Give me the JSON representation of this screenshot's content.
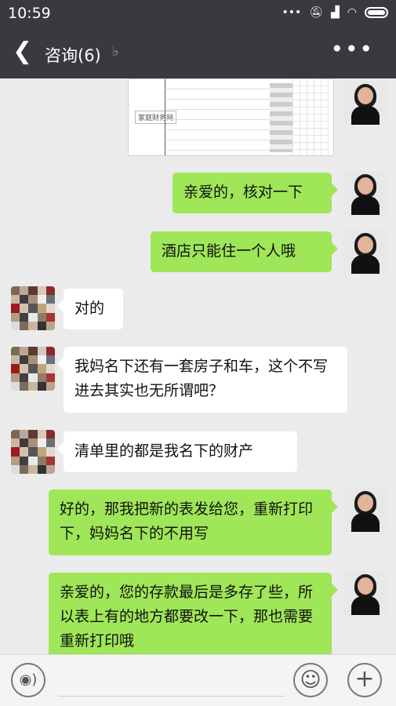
{
  "status_bar": {
    "time": "10:59",
    "icons": [
      "more-dots-icon",
      "mute-icon",
      "signal-icon",
      "wifi-icon",
      "battery-icon"
    ]
  },
  "header": {
    "back_icon": "back-arrow-icon",
    "title": "咨询(6)",
    "ear_icon": "ear-icon",
    "more_label": "•••"
  },
  "messages": [
    {
      "sender": "me",
      "type": "document-image",
      "stamp": "家庭财务网"
    },
    {
      "sender": "me",
      "type": "text",
      "text": "亲爱的，核对一下"
    },
    {
      "sender": "me",
      "type": "text",
      "text": "酒店只能住一个人哦"
    },
    {
      "sender": "other",
      "type": "text",
      "text": "对的"
    },
    {
      "sender": "other",
      "type": "text",
      "text": "我妈名下还有一套房子和车，这个不写进去其实也无所谓吧？"
    },
    {
      "sender": "other",
      "type": "text",
      "text": "清单里的都是我名下的财产"
    },
    {
      "sender": "me",
      "type": "text",
      "text": "好的，那我把新的表发给您，重新打印下，妈妈名下的不用写"
    },
    {
      "sender": "me",
      "type": "text",
      "text": "亲爱的，您的存款最后是多存了些，所以表上有的地方都要改一下，那也需要重新打印哦"
    }
  ],
  "input_bar": {
    "voice_icon": "voice-icon",
    "emoji_icon": "emoji-icon",
    "plus_icon": "plus-icon",
    "voice_glyph": "◉)",
    "emoji_glyph": "☺",
    "plus_glyph": "+"
  },
  "colors": {
    "header_bg": "#393a3f",
    "my_bubble": "#9fe658",
    "other_bubble": "#ffffff",
    "chat_bg": "#ebebeb"
  }
}
